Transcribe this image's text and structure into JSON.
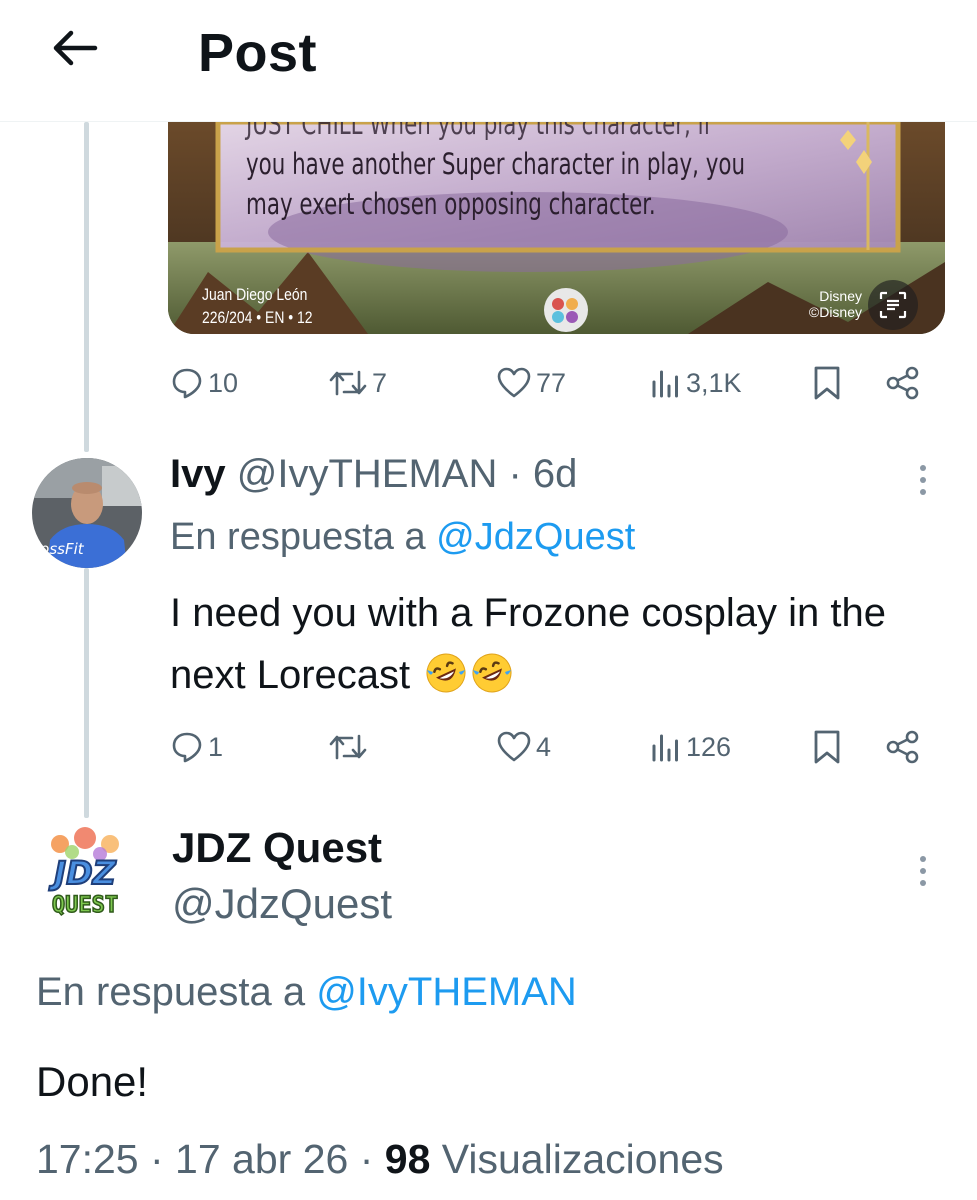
{
  "header": {
    "title": "Post"
  },
  "card": {
    "text_line_top": "JUST CHILL When you play this character, if",
    "text_line1": "you have another Super character in play, you",
    "text_line2": "may exert chosen opposing character.",
    "artist": "Juan Diego León",
    "number": "226/204 • EN • 12",
    "copyright_line1": "Disney",
    "copyright_line2": "©Disney"
  },
  "prev_actions": {
    "replies": "10",
    "reposts": "7",
    "likes": "77",
    "views": "3,1K"
  },
  "reply": {
    "name": "Ivy",
    "handle": "@IvyTHEMAN",
    "time": "· 6d",
    "reply_prefix": "En respuesta a",
    "reply_mention": "@JdzQuest",
    "text": "I need you with a Frozone cosplay in the next Lorecast",
    "emoji": [
      "rolling-on-floor-laughing",
      "rolling-on-floor-laughing"
    ],
    "avatar_text": "rossFit",
    "actions": {
      "replies": "1",
      "reposts": "",
      "likes": "4",
      "views": "126"
    }
  },
  "main": {
    "name": "JDZ Quest",
    "handle": "@JdzQuest",
    "avatar_line1": "JDZ",
    "avatar_line2": "QUEST",
    "reply_prefix": "En respuesta a",
    "reply_mention": "@IvyTHEMAN",
    "text": "Done!",
    "time": "17:25",
    "date": "· 17 abr 26 ·",
    "views_count": "98",
    "views_label": "Visualizaciones"
  },
  "colors": {
    "accent": "#1d9bf0",
    "secondary_text": "#536471",
    "primary_text": "#0f1419",
    "thread_line": "#cfd9de"
  }
}
